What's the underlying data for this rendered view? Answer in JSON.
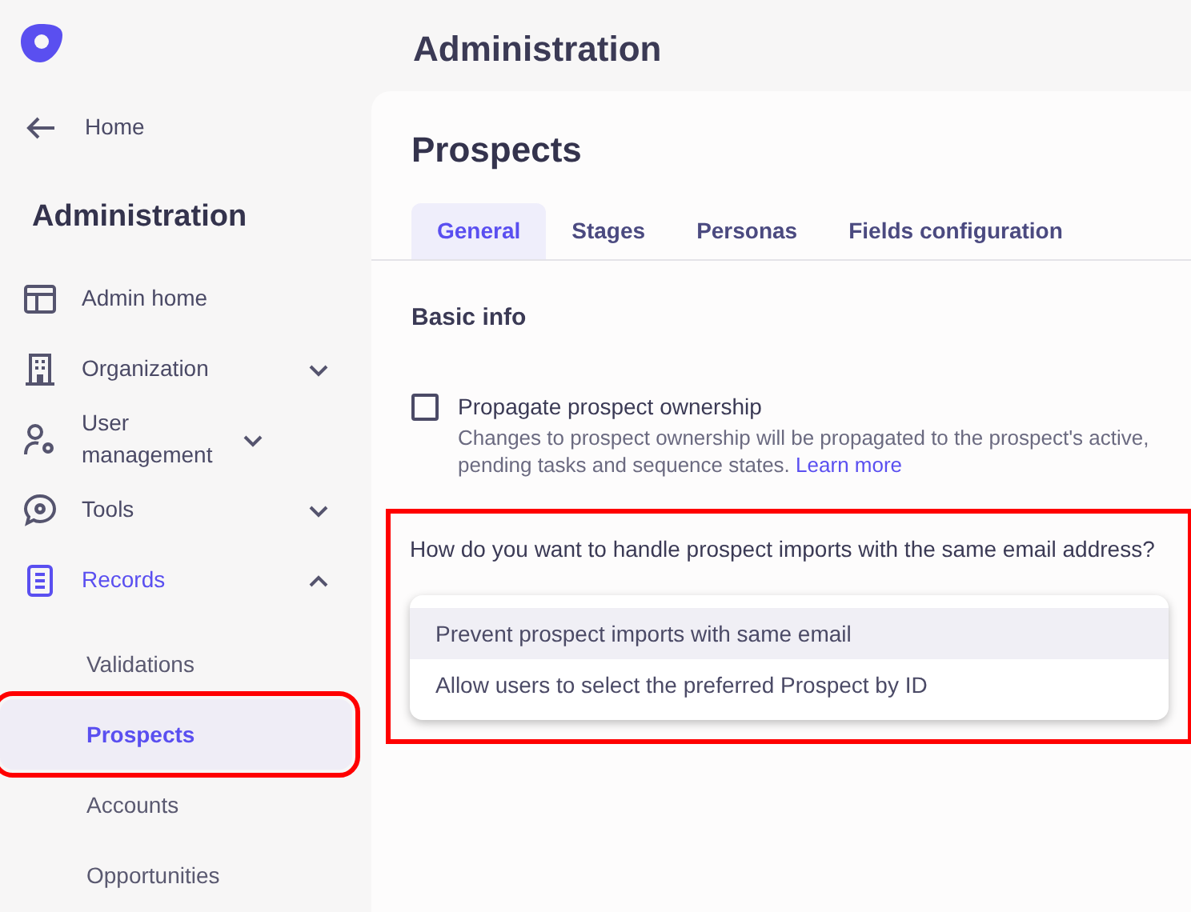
{
  "sidebar": {
    "back_link": {
      "label": "Home"
    },
    "heading": "Administration",
    "items": [
      {
        "label": "Admin home",
        "active": false
      },
      {
        "label": "Organization",
        "expanded": false,
        "active": false
      },
      {
        "label": "User management",
        "expanded": false,
        "active": false
      },
      {
        "label": "Tools",
        "expanded": false,
        "active": false
      },
      {
        "label": "Records",
        "expanded": true,
        "active": true,
        "children": [
          {
            "label": "Validations",
            "selected": false,
            "highlighted": false
          },
          {
            "label": "Prospects",
            "selected": true,
            "highlighted": true
          },
          {
            "label": "Accounts",
            "selected": false,
            "highlighted": false
          },
          {
            "label": "Opportunities",
            "selected": false,
            "highlighted": false
          }
        ]
      }
    ]
  },
  "header": {
    "title": "Administration"
  },
  "page": {
    "title": "Prospects",
    "tabs": [
      {
        "label": "General",
        "selected": true
      },
      {
        "label": "Stages",
        "selected": false
      },
      {
        "label": "Personas",
        "selected": false
      },
      {
        "label": "Fields configuration",
        "selected": false
      }
    ],
    "section_title": "Basic info",
    "checkbox": {
      "label": "Propagate prospect ownership",
      "checked": false,
      "description": "Changes to prospect ownership will be propagated to the prospect's active, pending tasks and sequence states.",
      "link": "Learn more"
    },
    "import_question": {
      "label": "How do you want to handle prospect imports with the same email address?",
      "highlighted": true,
      "options": [
        {
          "label": "Prevent prospect imports with same email",
          "selected": true
        },
        {
          "label": "Allow users to select the preferred Prospect by ID",
          "selected": false
        }
      ]
    }
  }
}
